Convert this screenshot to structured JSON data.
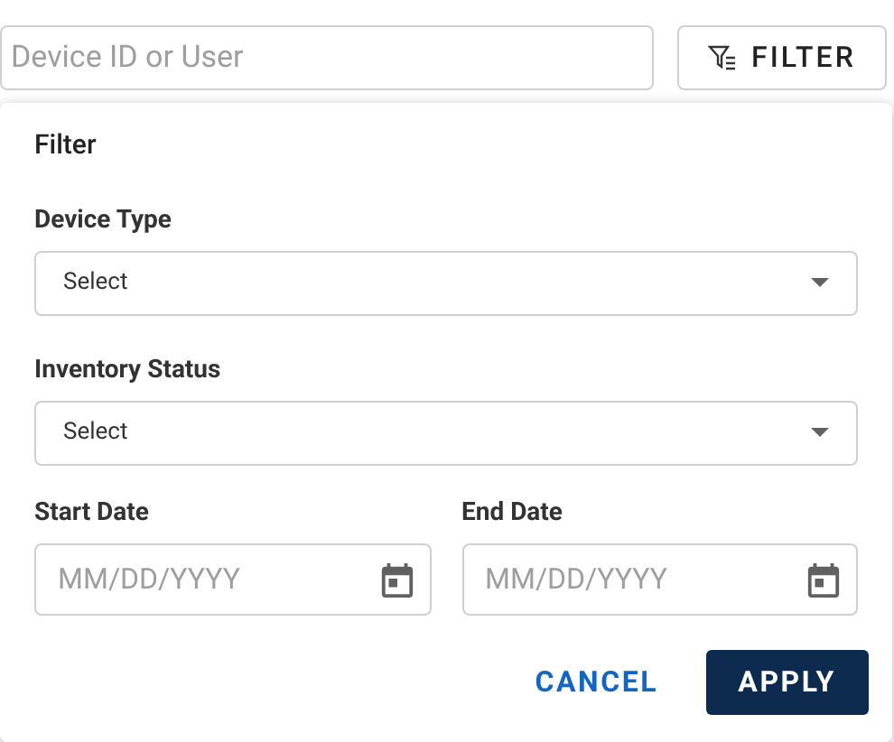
{
  "search": {
    "placeholder": "Device ID or User"
  },
  "filter_button": {
    "label": "FILTER"
  },
  "filter_panel": {
    "title": "Filter",
    "selects": [
      {
        "label": "Device Type",
        "value": "Select"
      },
      {
        "label": "Inventory Status",
        "value": "Select"
      }
    ],
    "dates": [
      {
        "label": "Start Date",
        "placeholder": "MM/DD/YYYY"
      },
      {
        "label": "End Date",
        "placeholder": "MM/DD/YYYY"
      }
    ],
    "buttons": [
      {
        "label": "CANCEL",
        "kind": "text"
      },
      {
        "label": "APPLY",
        "kind": "primary"
      }
    ]
  }
}
